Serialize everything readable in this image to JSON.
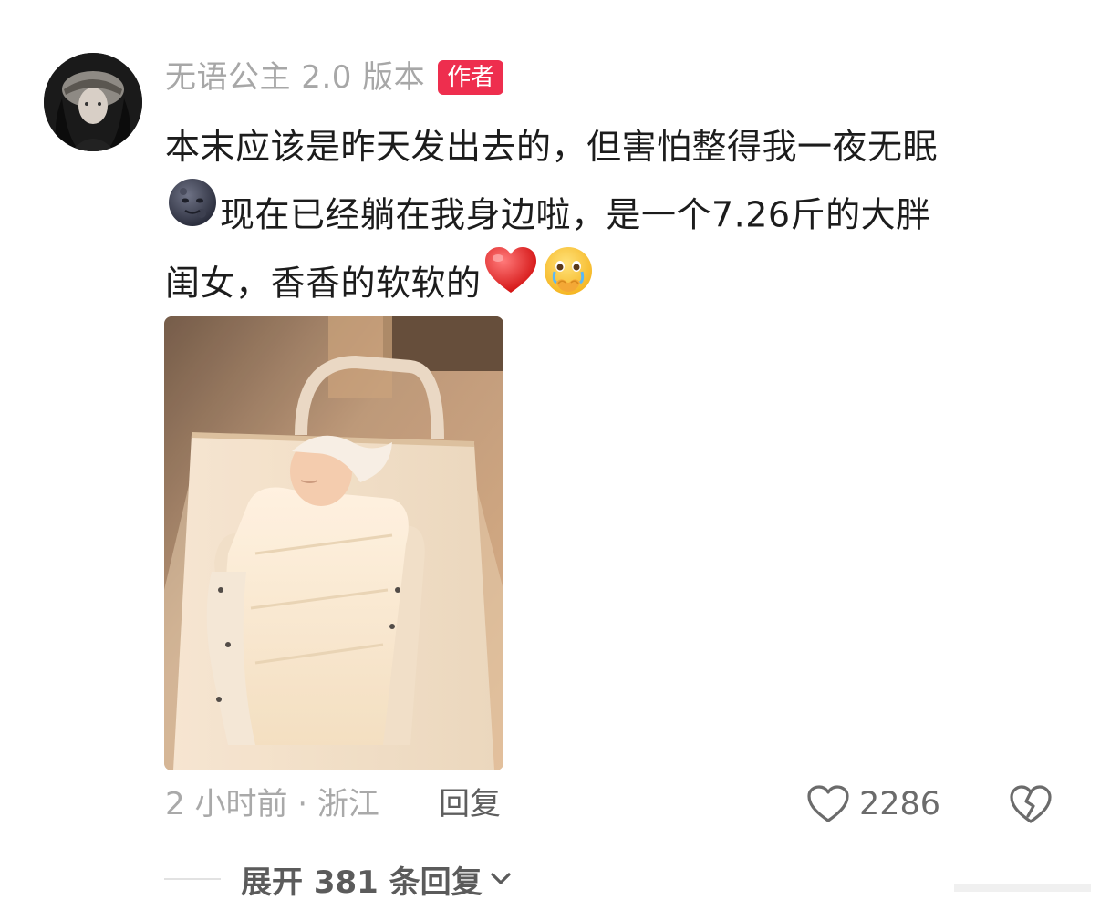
{
  "comment": {
    "author_name": "无语公主 2.0 版本",
    "author_badge": "作者",
    "text_lines": [
      "本末应该是昨天发出去的，但害怕整得我一夜无眠",
      "现在已经躺在我身边啦，是一个7.26斤的大胖",
      "闺女，香香的软软的"
    ],
    "emojis": {
      "line2_prefix": "new-moon-face-emoji",
      "line3_suffix_1": "red-heart-emoji",
      "line3_suffix_2": "face-holding-back-tears-emoji"
    },
    "photo_description_icon": "newborn-baby-photo",
    "time_location": "2 小时前 · 浙江",
    "reply_label": "回复",
    "like_count": "2286",
    "expand_replies_label": "展开 381 条回复"
  },
  "colors": {
    "badge": "#ee2e4e",
    "muted_text": "#a9a9a9",
    "main_text": "#1c1c1c"
  }
}
